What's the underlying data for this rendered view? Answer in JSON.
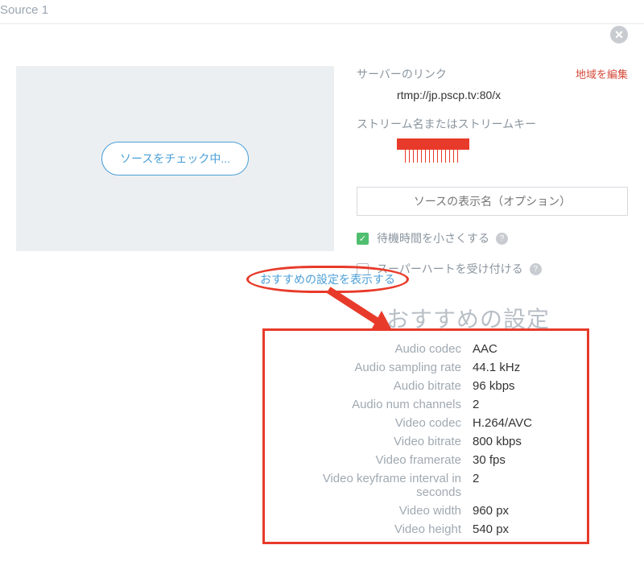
{
  "source_label": "Source 1",
  "check_button": "ソースをチェック中...",
  "server": {
    "label": "サーバーのリンク",
    "region_edit": "地域を編集",
    "value": "rtmp://jp.pscp.tv:80/x"
  },
  "stream_key_label": "ストリーム名またはストリームキー",
  "display_name_placeholder": "ソースの表示名（オプション）",
  "low_latency": {
    "label": "待機時間を小さくする",
    "checked": true
  },
  "super_hearts": {
    "label": "スーパーハートを受け付ける",
    "checked": false
  },
  "recommend_link": "おすすめの設定を表示する",
  "settings_heading": "おすすめの設定",
  "settings": [
    {
      "label": "Audio codec",
      "value": "AAC"
    },
    {
      "label": "Audio sampling rate",
      "value": "44.1 kHz"
    },
    {
      "label": "Audio bitrate",
      "value": "96 kbps"
    },
    {
      "label": "Audio num channels",
      "value": "2"
    },
    {
      "label": "Video codec",
      "value": "H.264/AVC"
    },
    {
      "label": "Video bitrate",
      "value": "800 kbps"
    },
    {
      "label": "Video framerate",
      "value": "30 fps"
    },
    {
      "label": "Video keyframe interval in seconds",
      "value": "2"
    },
    {
      "label": "Video width",
      "value": "960 px"
    },
    {
      "label": "Video height",
      "value": "540 px"
    }
  ]
}
